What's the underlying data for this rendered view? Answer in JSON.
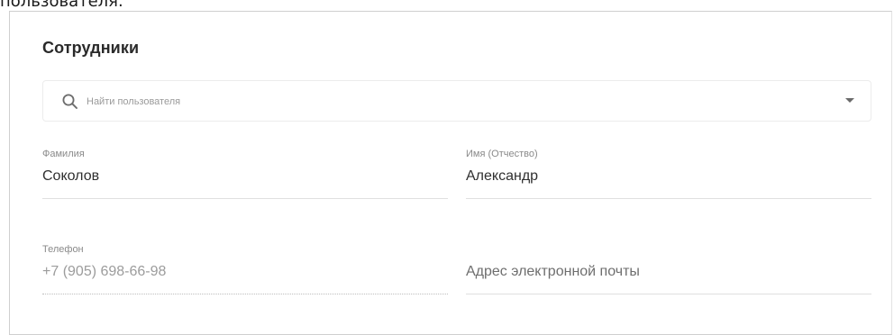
{
  "page": {
    "caption": "пользователя."
  },
  "card": {
    "title": "Сотрудники"
  },
  "search": {
    "placeholder": "Найти пользователя",
    "value": ""
  },
  "fields": {
    "last_name": {
      "label": "Фамилия",
      "value": "Соколов"
    },
    "first_name": {
      "label": "Имя (Отчество)",
      "value": "Александр"
    },
    "phone": {
      "label": "Телефон",
      "value": "+7 (905) 698-66-98"
    },
    "email": {
      "label": "",
      "placeholder": "Адрес электронной почты",
      "value": ""
    }
  },
  "icons": {
    "search": "search-icon",
    "dropdown": "chevron-down-icon"
  }
}
